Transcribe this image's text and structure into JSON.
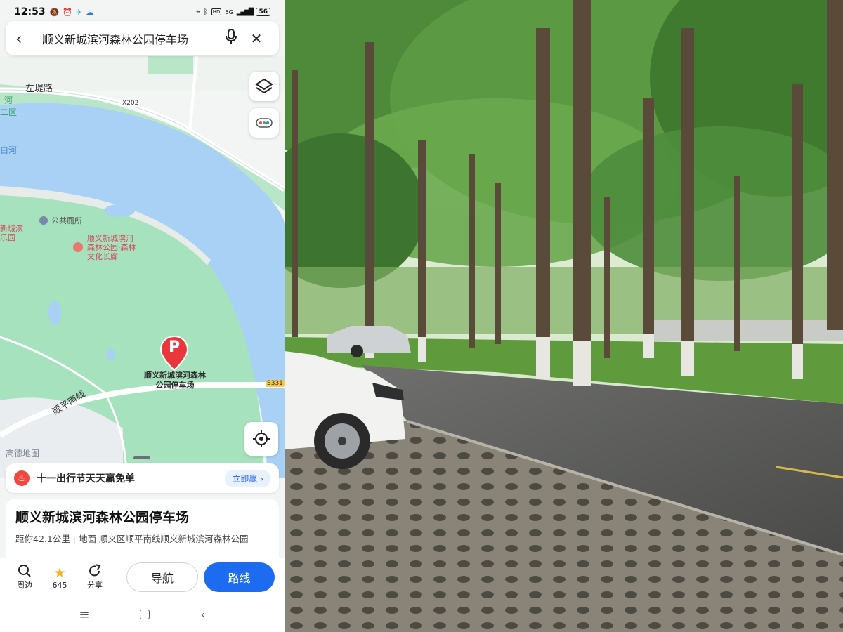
{
  "status_bar": {
    "time": "12:53",
    "left_icons": [
      "notification-muted-icon",
      "alarm-icon",
      "telegram-icon",
      "cloud-icon"
    ],
    "right_icons": [
      "location-icon",
      "bluetooth-icon",
      "hd-icon",
      "5g-signal-icon"
    ],
    "network": "5G",
    "hd": "HD",
    "battery": "56"
  },
  "search": {
    "query": "顺义新城滨河森林公园停车场",
    "back_icon": "chevron-left-icon",
    "mic_icon": "microphone-icon",
    "clear_icon": "close-icon"
  },
  "map": {
    "road_labels": {
      "zuodi": "左堤路",
      "x202": "X202",
      "shunping": "顺平南线",
      "s331": "S331"
    },
    "edge_labels": {
      "river_a": "河",
      "river_b": "二区",
      "river_c": "白河"
    },
    "poi": {
      "toilet": "公共厕所",
      "culture_corridor": "顺义新城滨河森林公园·森林文化长廊",
      "left_park": "新城滨乐园"
    },
    "pin_label": "顺义新城滨河森林公园停车场",
    "pin_letter": "P",
    "watermark": "高德地图",
    "colors": {
      "water": "#a8d1f5",
      "park": "#a6e2bd",
      "land": "#f3f5f4",
      "pin": "#e8383d"
    }
  },
  "controls": {
    "layers_icon": "layers-icon",
    "more_icon": "more-dots-icon",
    "locate_icon": "locate-icon"
  },
  "promo": {
    "text": "十一出行节天天赢免单",
    "button": "立即赢"
  },
  "place": {
    "title": "顺义新城滨河森林公园停车场",
    "distance": "距你42.1公里",
    "address": "地面 顺义区顺平南线顺义新城滨河森林公园"
  },
  "actions": {
    "nearby": "周边",
    "favorites_count": "645",
    "share": "分享",
    "navigate": "导航",
    "route": "路线"
  },
  "system_nav": [
    "menu-icon",
    "home-icon",
    "back-icon"
  ]
}
